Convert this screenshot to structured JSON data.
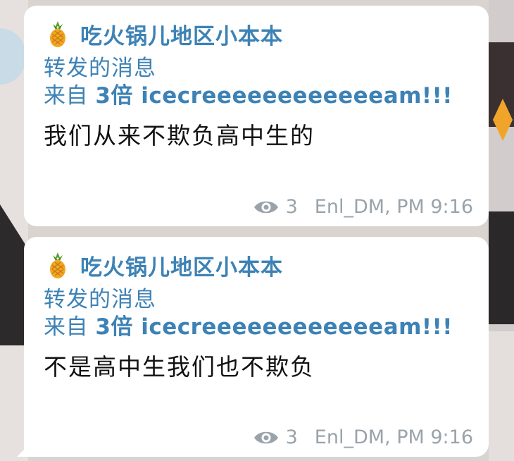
{
  "messages": [
    {
      "channel_icon": "pineapple-icon",
      "channel_name": "吃火锅儿地区小本本",
      "forwarded_label": "转发的消息",
      "forwarded_prefix": "来自 ",
      "forwarded_source": "3倍 icecreeeeeeeeeeeeam!!!",
      "text": "我们从来不欺负高中生的",
      "views": "3",
      "author_time": "Enl_DM, PM 9:16"
    },
    {
      "channel_icon": "pineapple-icon",
      "channel_name": "吃火锅儿地区小本本",
      "forwarded_label": "转发的消息",
      "forwarded_prefix": "来自 ",
      "forwarded_source": "3倍 icecreeeeeeeeeeeeam!!!",
      "text": "不是高中生我们也不欺负",
      "views": "3",
      "author_time": "Enl_DM, PM 9:16"
    }
  ],
  "colors": {
    "accent": "#3d82b5",
    "meta": "#9aa3aa",
    "bubble": "#ffffff",
    "text": "#111111"
  }
}
